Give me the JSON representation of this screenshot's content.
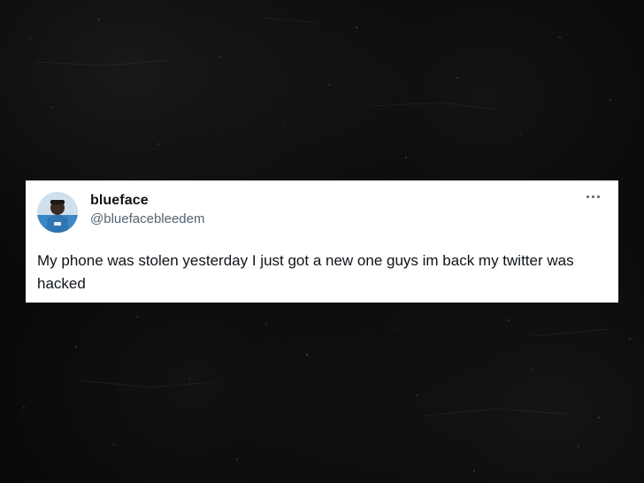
{
  "tweet": {
    "display_name": "blueface",
    "handle": "@bluefacebleedem",
    "text": "My phone was stolen yesterday I just got a new one guys im back my twitter was hacked",
    "more_icon": "more-horizontal-icon",
    "avatar_icon": "avatar-photo-icon"
  },
  "colors": {
    "background": "#060606",
    "card": "#ffffff",
    "name_text": "#0f1419",
    "handle_text": "#536471"
  }
}
